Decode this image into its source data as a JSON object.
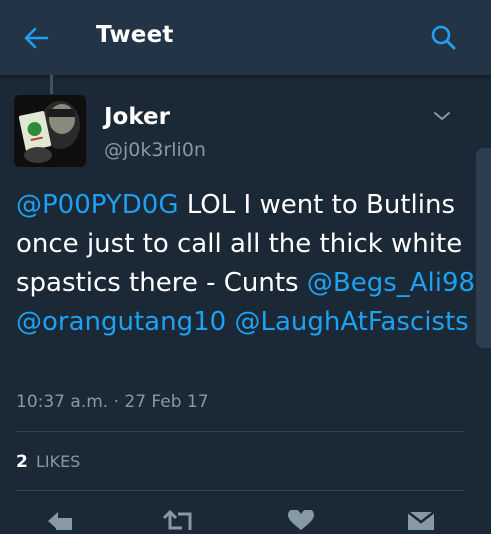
{
  "header": {
    "title": "Tweet",
    "back_icon": "arrow-left-icon",
    "search_icon": "search-icon"
  },
  "tweet": {
    "author_name": "Joker",
    "author_handle": "@j0k3rli0n",
    "text_parts": {
      "mention_1": "@P00PYD0G",
      "body": " LOL I went to Butlins once just to call all the thick white spastics there - Cunts ",
      "mention_2": "@Begs_Ali98",
      "mention_3": "@orangutang10",
      "mention_4": "@LaughAtFascists"
    },
    "timestamp": "10:37 a.m. · 27 Feb 17",
    "likes_count": "2",
    "likes_label": "LIKES"
  },
  "actions": [
    "reply-icon",
    "retweet-icon",
    "like-icon",
    "message-icon"
  ],
  "colors": {
    "background": "#1b2836",
    "header": "#243447",
    "accent": "#1da1f2",
    "secondary_text": "#8899a6"
  }
}
